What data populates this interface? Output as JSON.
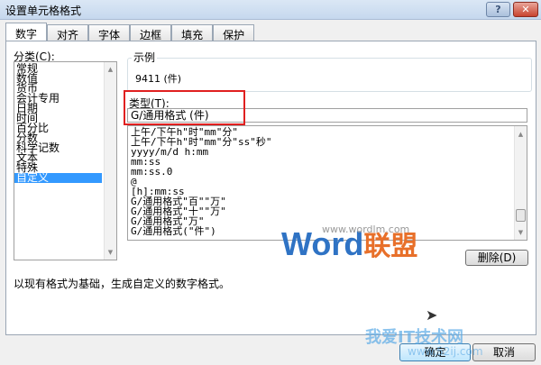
{
  "window": {
    "title": "设置单元格格式",
    "help": "?",
    "close": "✕"
  },
  "tabs": [
    {
      "label": "数字"
    },
    {
      "label": "对齐"
    },
    {
      "label": "字体"
    },
    {
      "label": "边框"
    },
    {
      "label": "填充"
    },
    {
      "label": "保护"
    }
  ],
  "category": {
    "label": "分类(C):",
    "items": [
      "常规",
      "数值",
      "货币",
      "会计专用",
      "日期",
      "时间",
      "百分比",
      "分数",
      "科学记数",
      "文本",
      "特殊",
      "自定义"
    ],
    "selected": "自定义"
  },
  "sample": {
    "label": "示例",
    "value": "9411 (件)"
  },
  "type": {
    "label": "类型(T):",
    "value": "G/通用格式 (件)"
  },
  "formats": [
    "上午/下午h\"时\"mm\"分\"",
    "上午/下午h\"时\"mm\"分\"ss\"秒\"",
    "yyyy/m/d h:mm",
    "mm:ss",
    "mm:ss.0",
    "@",
    "[h]:mm:ss",
    "G/通用格式\"百\"\"万\"",
    "G/通用格式\"十\"\"万\"",
    "G/通用格式\"万\"",
    "G/通用格式(\"件\")"
  ],
  "delete_button": "删除(D)",
  "description": "以现有格式为基础，生成自定义的数字格式。",
  "ok_button": "确定",
  "cancel_button": "取消",
  "watermarks": {
    "word_logo": "Word",
    "word_logo_cn": "联盟",
    "word_url": "www.wordlm.com",
    "site_logo": "我爱IT技术网",
    "site_url": "www.52ij.com"
  },
  "colors": {
    "selection": "#3399ff",
    "highlight_box": "#e02020"
  }
}
